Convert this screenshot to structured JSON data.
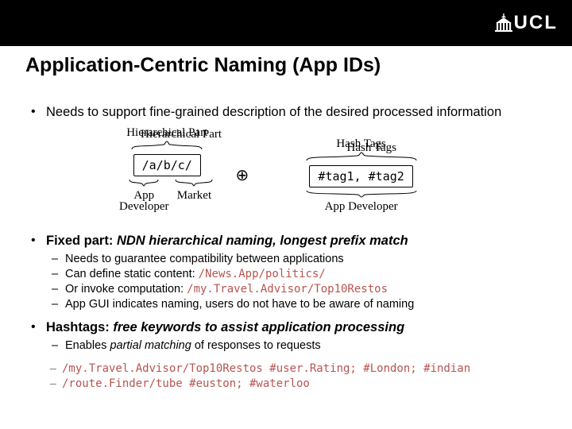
{
  "header": {
    "logo_text_prefix": "UCL"
  },
  "title": "Application-Centric Naming (App IDs)",
  "bullets": {
    "b1": "Needs to support fine-grained description of the desired processed information",
    "b2_lead": "Fixed part:",
    "b2_rest": " NDN hierarchical naming, longest prefix match",
    "b2_sub": {
      "s1": "Needs to guarantee compatibility between applications",
      "s2a": "Can define static content: ",
      "s2b": "/News.App/politics/",
      "s3a": "Or invoke computation: ",
      "s3b": "/my.Travel.Advisor/Top10Restos",
      "s4": "App GUI indicates naming, users do not have to be aware of naming"
    },
    "b3_lead": "Hashtags:",
    "b3_rest": " free keywords to assist application processing",
    "b3_sub": {
      "s1a": "Enables ",
      "s1b": "partial matching",
      "s1c": " of responses to requests",
      "s2": "/my.Travel.Advisor/Top10Restos #user.Rating; #London; #indian",
      "s3": "/route.Finder/tube #euston; #waterloo"
    }
  },
  "diagram": {
    "top_left_label": "Hierarchical Part",
    "top_right_label": "Hash Tags",
    "left_box": "/a/b/c/",
    "oplus": "⊕",
    "right_box": "#tag1, #tag2",
    "under_left_a": "App",
    "under_left_b": "Market",
    "under_right": "App Developer",
    "under_left_sub": "Developer"
  }
}
